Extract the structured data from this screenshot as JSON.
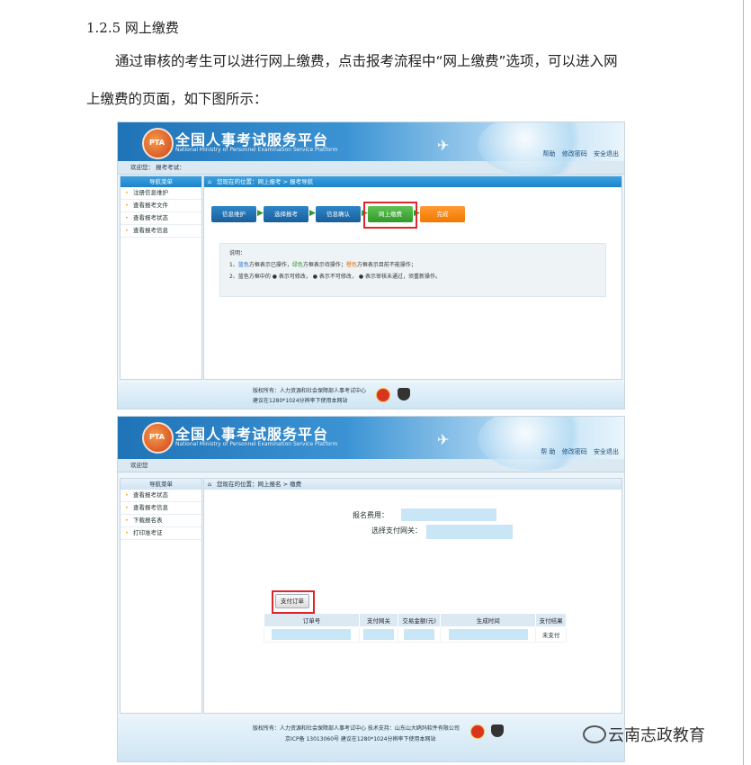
{
  "doc": {
    "heading": "1.2.5 网上缴费",
    "para1": "通过审核的考生可以进行网上缴费，点击报考流程中“网上缴费”选项，可以进入网",
    "para2": "上缴费的页面，如下图所示："
  },
  "shot1": {
    "brand_title": "全国人事考试服务平台",
    "brand_sub": "National Ministry of Personnel Examination Service Platform",
    "logo_text": "PTA",
    "toplinks": [
      "帮助",
      "修改密码",
      "安全退出"
    ],
    "welcome": "欢迎您：          报考考试：",
    "sidebar_title": "导航菜单",
    "sidebar_items": [
      "注册信息维护",
      "查看报考文件",
      "查看报考状态",
      "查看报考信息"
    ],
    "crumb": "您现在的位置：网上报考 > 报考导航",
    "steps": [
      "信息维护",
      "选择报考",
      "信息确认",
      "网上缴费",
      "完成"
    ],
    "note_title": "说明：",
    "note_line1_prefix": "1、",
    "note_line1_blue": "蓝色",
    "note_line1_a": "方框表示已操作，",
    "note_line1_green": "绿色",
    "note_line1_b": "方框表示待操作；",
    "note_line1_orange": "橙色",
    "note_line1_c": "方框表示目前不能操作；",
    "note_line2": "2、蓝色方框中的 ● 表示可修改， ● 表示不可修改， ● 表示审核未通过，须重新操作。",
    "footer1": "版权所有：人力资源和社会保障部人事考试中心",
    "footer2": "建议在1280*1024分辨率下使用本网站"
  },
  "shot2": {
    "brand_title": "全国人事考试服务平台",
    "brand_sub": "National Ministry of Personnel Examination Service Platform",
    "logo_text": "PTA",
    "toplinks": [
      "帮 助",
      "修改密码",
      "安全退出"
    ],
    "welcome": "欢迎您",
    "sidebar_title": "导航菜单",
    "sidebar_items": [
      "查看报考状态",
      "查看报考信息",
      "下载报名表",
      "打印准考证"
    ],
    "crumb": "您现在的位置：网上报名 > 缴费",
    "fee_label": "报名费用：",
    "gateway_label": "选择支付网关：",
    "table_headers": [
      "订单号",
      "支付网关",
      "交易金额(元)",
      "生成时间",
      "支付结果"
    ],
    "table_row_status": "未支付",
    "pay_button": "支付订单",
    "footer1": "版权所有：人力资源和社会保障部人事考试中心  技术支持：山东山大鸥玛软件有限公司",
    "footer2": "京ICP备 13013060号  建议在1280*1024分辨率下使用本网站"
  },
  "watermark": "云南志政教育"
}
